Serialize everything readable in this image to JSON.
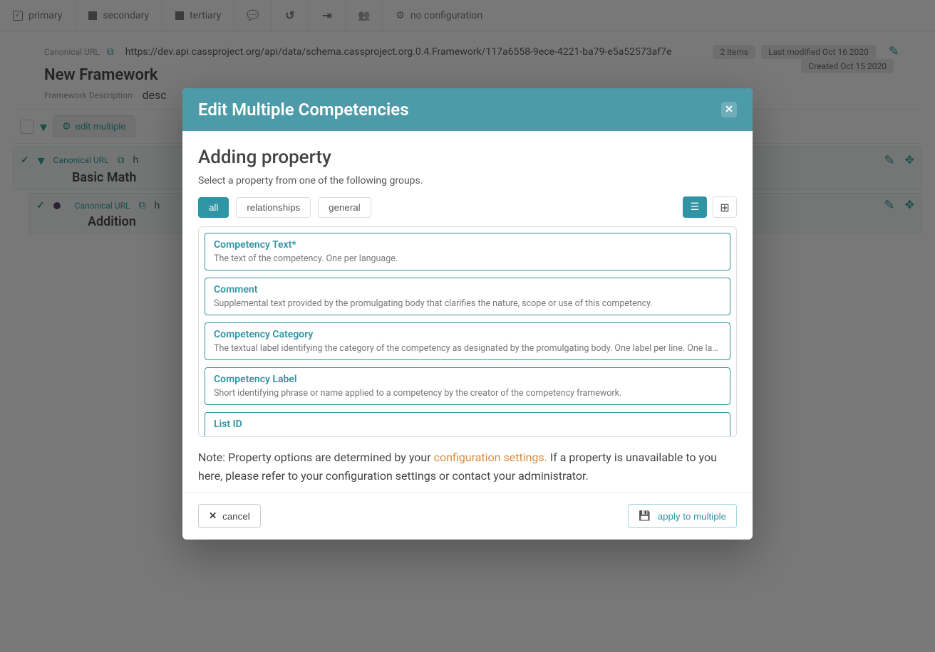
{
  "topbar": {
    "primary": "primary",
    "secondary": "secondary",
    "tertiary": "tertiary",
    "noconfig": "no configuration"
  },
  "header": {
    "canonical_label": "Canonical URL",
    "canonical_url": "https://dev.api.cassproject.org/api/data/schema.cassproject.org.0.4.Framework/117a6558-9ece-4221-ba79-e5a52573af7e",
    "badges": {
      "items": "2 items",
      "modified": "Last modified Oct 16 2020",
      "created": "Created Oct 15 2020"
    },
    "title": "New Framework",
    "desc_label": "Framework Description",
    "desc_value": "desc"
  },
  "toolbar": {
    "edit_multiple": "edit multiple"
  },
  "competencies": [
    {
      "canonical_label": "Canonical URL",
      "url_prefix": "h",
      "title": "Basic Math"
    },
    {
      "canonical_label": "Canonical URL",
      "url_prefix": "h",
      "title": "Addition"
    }
  ],
  "modal": {
    "title": "Edit Multiple Competencies",
    "section_title": "Adding property",
    "section_sub": "Select a property from one of the following groups.",
    "tabs": {
      "all": "all",
      "relationships": "relationships",
      "general": "general"
    },
    "properties": [
      {
        "title": "Competency Text*",
        "desc": "The text of the competency. One per language."
      },
      {
        "title": "Comment",
        "desc": "Supplemental text provided by the promulgating body that clarifies the nature, scope or use of this competency."
      },
      {
        "title": "Competency Category",
        "desc": "The textual label identifying the category of the competency as designated by the promulgating body. One label per line. One lab…"
      },
      {
        "title": "Competency Label",
        "desc": "Short identifying phrase or name applied to a competency by the creator of the competency framework."
      },
      {
        "title": "List ID",
        "desc": ""
      }
    ],
    "note_prefix": "Note: Property options are determined by your ",
    "note_link": "configuration settings.",
    "note_suffix": " If a property is unavailable to you here, please refer to your configuration settings or contact your administrator.",
    "cancel": "cancel",
    "apply": "apply to multiple"
  }
}
